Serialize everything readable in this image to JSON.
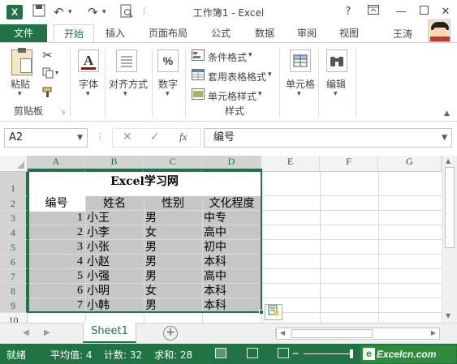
{
  "titlebar": {
    "app_icon": "X",
    "title": "工作簿1 - Excel",
    "help": "?",
    "icons": [
      "excel-icon",
      "undo-icon",
      "redo-icon",
      "print-preview-icon",
      "customize-icon",
      "help-icon",
      "restore-ribbon-icon",
      "minimize-icon",
      "maximize-icon",
      "close-icon"
    ]
  },
  "tabs": [
    "文件",
    "开始",
    "插入",
    "页面布局",
    "公式",
    "数据",
    "审阅",
    "视图"
  ],
  "user": {
    "name": "王涛"
  },
  "ribbon": {
    "clipboard": {
      "paste": "粘贴",
      "group": "剪贴板"
    },
    "font": "字体",
    "alignment": "对齐方式",
    "number": "数字",
    "number_symbol": "%",
    "styles": {
      "conditional": "条件格式",
      "table": "套用表格格式",
      "cell_styles": "单元格样式",
      "group": "样式"
    },
    "cells": "单元格",
    "editing": "编辑"
  },
  "formula_bar": {
    "name_box": "A2",
    "fx": "fx",
    "content": "编号"
  },
  "grid": {
    "columns": [
      "A",
      "B",
      "C",
      "D",
      "E",
      "F",
      "G"
    ],
    "rows": [
      "1",
      "2",
      "3",
      "4",
      "5",
      "6",
      "7",
      "8",
      "9",
      "10"
    ],
    "title": "Excel学习网",
    "headers": [
      "编号",
      "姓名",
      "性别",
      "文化程度"
    ],
    "records": [
      [
        "1",
        "小王",
        "男",
        "中专"
      ],
      [
        "2",
        "小李",
        "女",
        "高中"
      ],
      [
        "3",
        "小张",
        "男",
        "初中"
      ],
      [
        "4",
        "小赵",
        "男",
        "本科"
      ],
      [
        "5",
        "小强",
        "男",
        "高中"
      ],
      [
        "6",
        "小明",
        "女",
        "本科"
      ],
      [
        "7",
        "小韩",
        "男",
        "本科"
      ]
    ]
  },
  "sheets": {
    "active": "Sheet1",
    "add": "+"
  },
  "statusbar": {
    "mode": "就绪",
    "average": "平均值: 4",
    "count": "计数: 32",
    "sum": "求和: 28"
  },
  "watermark": "Excelcn.com",
  "accent_color": "#217346"
}
